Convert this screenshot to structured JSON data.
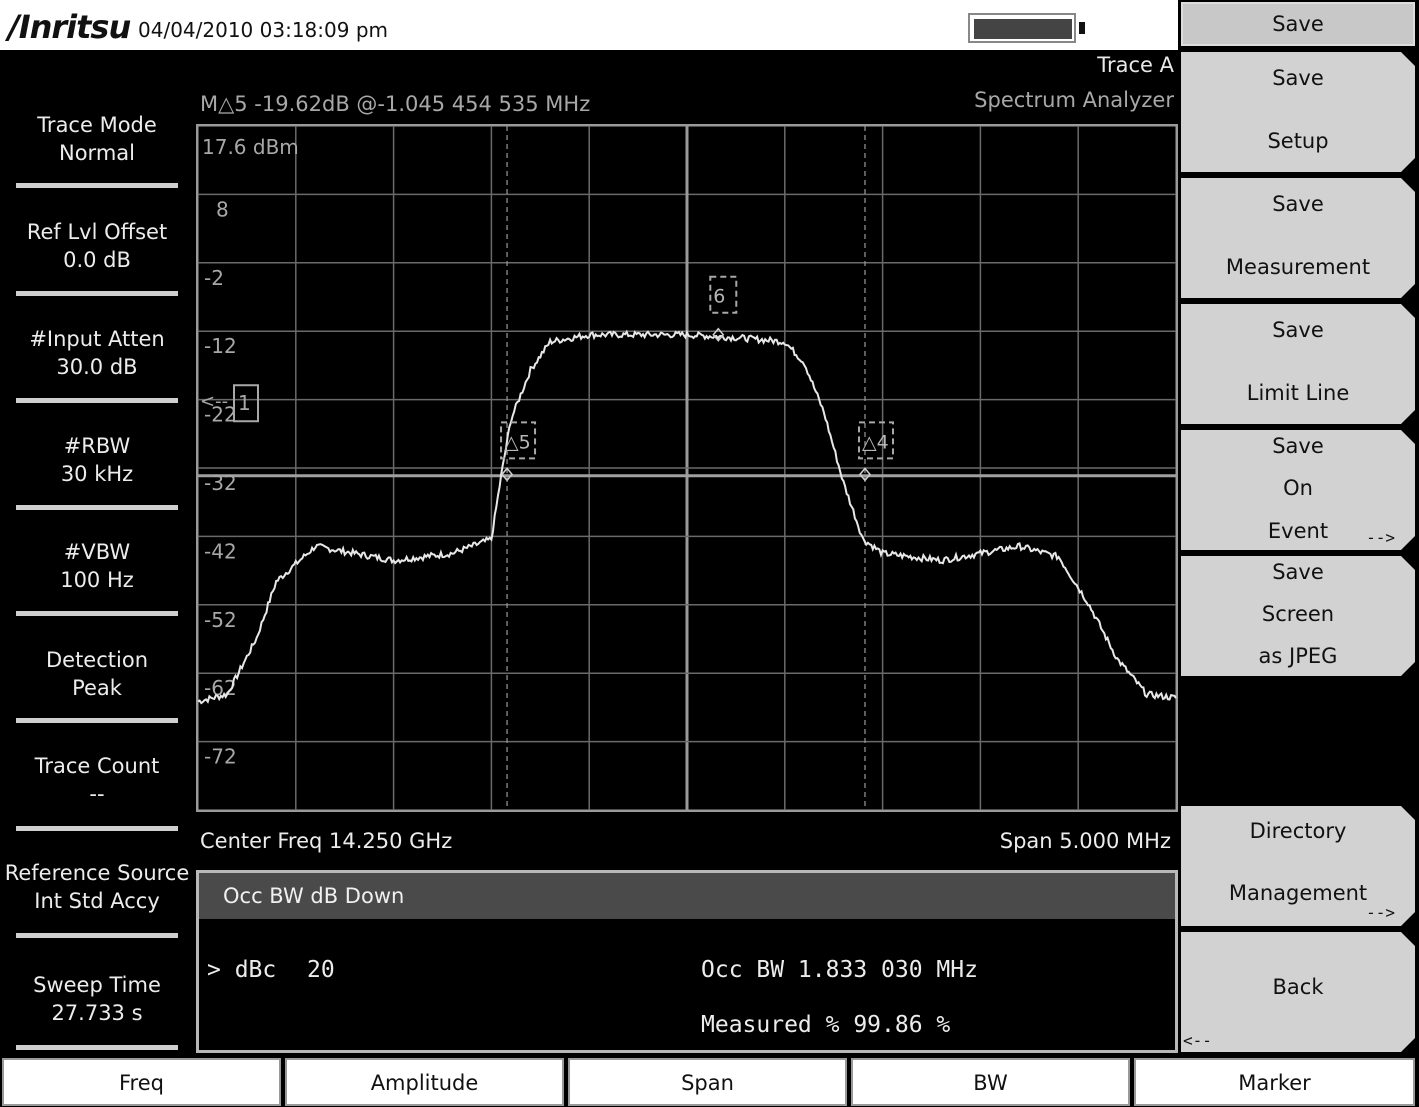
{
  "header": {
    "logo": "/Inritsu",
    "datetime": "04/04/2010 03:18:09 pm"
  },
  "left_panel": [
    {
      "line1": "Trace Mode",
      "line2": "Normal"
    },
    {
      "line1": "Ref Lvl Offset",
      "line2": "0.0 dB"
    },
    {
      "line1": "#Input Atten",
      "line2": "30.0 dB"
    },
    {
      "line1": "#RBW",
      "line2": "30 kHz"
    },
    {
      "line1": "#VBW",
      "line2": "100 Hz"
    },
    {
      "line1": "Detection",
      "line2": "Peak"
    },
    {
      "line1": "Trace Count",
      "line2": "--"
    },
    {
      "line1": "Reference Source",
      "line2": "Int Std Accy"
    },
    {
      "line1": "Sweep Time",
      "line2": "27.733 s"
    }
  ],
  "graph": {
    "trace_label": "Trace A",
    "mode_label": "Spectrum Analyzer",
    "marker_readout": "M△5 -19.62dB @-1.045 454 535 MHz",
    "ref_level": "17.6 dBm",
    "y_ticks": [
      "8",
      "-2",
      "-12",
      "-22",
      "-32",
      "-42",
      "-52",
      "-62",
      "-72"
    ],
    "center_freq": "Center Freq 14.250 GHz",
    "span": "Span 5.000 MHz",
    "markers": {
      "ref": "1",
      "m5": "△5",
      "m6": "6",
      "m4": "△4"
    }
  },
  "chart_data": {
    "type": "line",
    "title": "",
    "xlabel": "",
    "ylabel": "",
    "x_unit": "MHz offset from center",
    "xlim": [
      -2.5,
      2.5
    ],
    "ylim": [
      -79.4,
      17.6
    ],
    "x": [
      -2.5,
      -2.35,
      -2.2,
      -2.1,
      -1.9,
      -1.5,
      -1.2,
      -1.0,
      -0.95,
      -0.9,
      -0.8,
      -0.7,
      -0.5,
      0,
      0.3,
      0.5,
      0.6,
      0.7,
      0.8,
      0.9,
      1.0,
      1.3,
      1.7,
      1.9,
      2.05,
      2.2,
      2.35,
      2.5
    ],
    "series": [
      {
        "values": [
          -64,
          -63,
          -55,
          -47,
          -42,
          -44,
          -43,
          -41,
          -32,
          -24,
          -17,
          -13,
          -12,
          -12,
          -12.5,
          -13,
          -16,
          -23,
          -33,
          -41,
          -43,
          -44,
          -42,
          -43.5,
          -50,
          -58,
          -63,
          -63.5
        ]
      }
    ],
    "reference_line_y": -32,
    "markers": [
      {
        "name": "△5",
        "x": -0.92,
        "y": -31.8
      },
      {
        "name": "6",
        "x": 0.16,
        "y": -12
      },
      {
        "name": "△4",
        "x": 0.91,
        "y": -31.8
      }
    ],
    "grid": true
  },
  "measurement": {
    "title": "Occ BW dB Down",
    "dbc_label": "> dBc",
    "dbc_value": "20",
    "occ_bw": "Occ BW 1.833 030 MHz",
    "measured": "Measured % 99.86 %"
  },
  "softkeys": {
    "title": "Save",
    "keys": [
      {
        "line1": "Save",
        "line2": "Setup"
      },
      {
        "line1": "Save",
        "line2": "Measurement"
      },
      {
        "line1": "Save",
        "line2": "Limit Line"
      },
      {
        "line1": "Save",
        "line2": "On",
        "line3": "Event",
        "arrow": "-->"
      },
      {
        "line1": "Save",
        "line2": "Screen",
        "line3": "as JPEG"
      },
      {
        "line1": "Directory",
        "line2": "Management",
        "arrow": "-->"
      },
      {
        "line1": "Back",
        "back_arrow": "<--"
      }
    ]
  },
  "bottom_tabs": [
    "Freq",
    "Amplitude",
    "Span",
    "BW",
    "Marker"
  ]
}
